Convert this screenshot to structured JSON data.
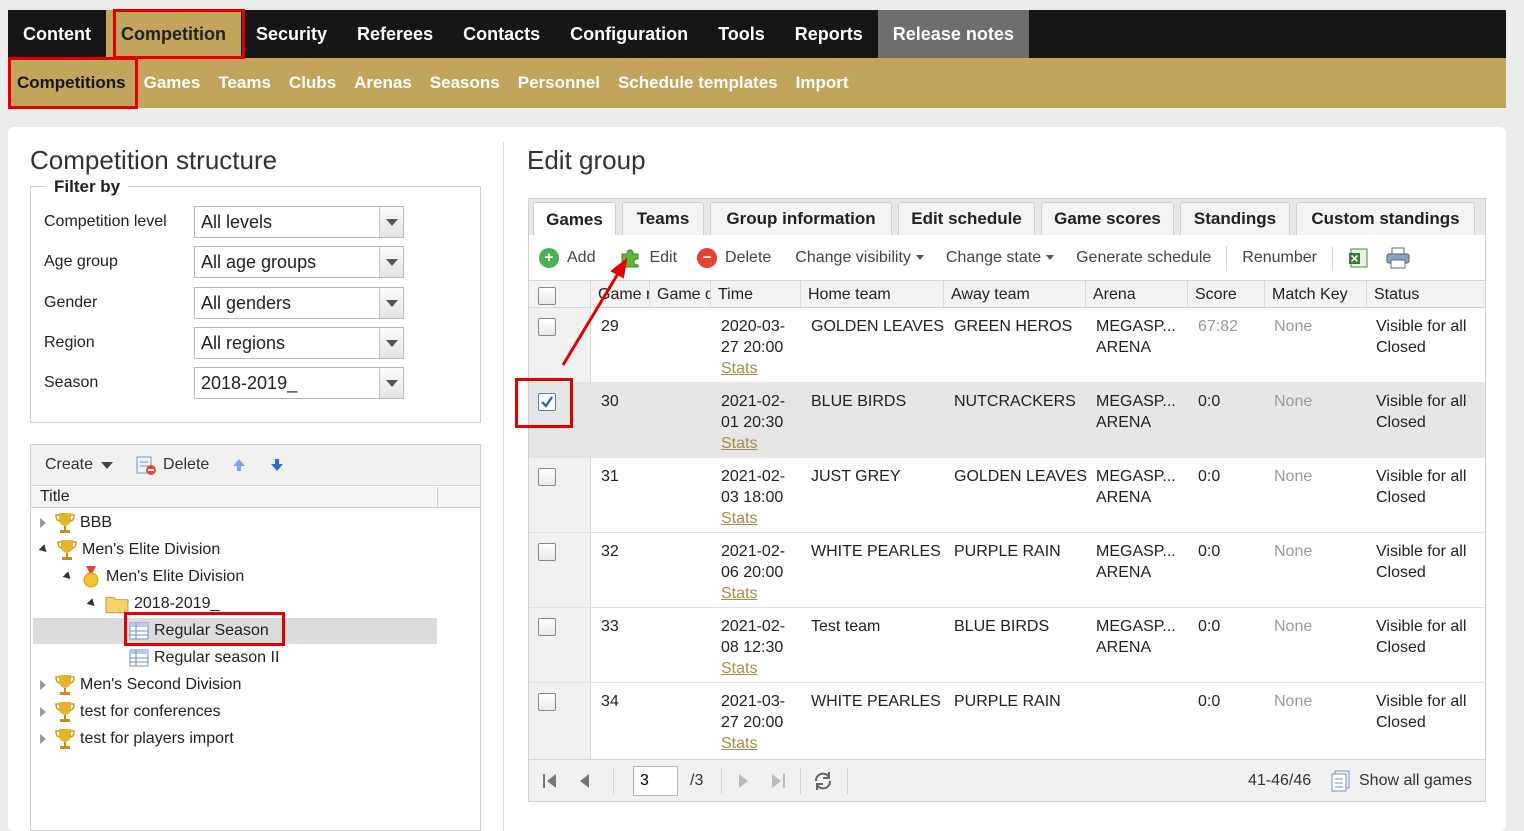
{
  "topnav": {
    "items": [
      "Content",
      "Competition",
      "Security",
      "Referees",
      "Contacts",
      "Configuration",
      "Tools",
      "Reports",
      "Release notes"
    ]
  },
  "subnav": {
    "items": [
      "Competitions",
      "Games",
      "Teams",
      "Clubs",
      "Arenas",
      "Seasons",
      "Personnel",
      "Schedule templates",
      "Import"
    ]
  },
  "left": {
    "title": "Competition structure",
    "filter_legend": "Filter by",
    "filters": [
      {
        "label": "Competition level",
        "value": "All levels"
      },
      {
        "label": "Age group",
        "value": "All age groups"
      },
      {
        "label": "Gender",
        "value": "All genders"
      },
      {
        "label": "Region",
        "value": "All regions"
      },
      {
        "label": "Season",
        "value": "2018-2019_"
      }
    ],
    "tree_toolbar": {
      "create": "Create",
      "delete": "Delete"
    },
    "tree_header": "Title",
    "tree": [
      {
        "label": "BBB"
      },
      {
        "label": "Men's Elite Division"
      },
      {
        "label": "Men's Elite Division"
      },
      {
        "label": "2018-2019_"
      },
      {
        "label": "Regular Season"
      },
      {
        "label": "Regular season II"
      },
      {
        "label": "Men's Second Division"
      },
      {
        "label": "test for conferences"
      },
      {
        "label": "test for players import"
      }
    ]
  },
  "right": {
    "title": "Edit group",
    "tabs": [
      "Games",
      "Teams",
      "Group information",
      "Edit schedule",
      "Game scores",
      "Standings",
      "Custom standings"
    ],
    "toolbar": {
      "add": "Add",
      "edit": "Edit",
      "delete": "Delete",
      "change_visibility": "Change visibility",
      "change_state": "Change state",
      "generate_schedule": "Generate schedule",
      "renumber": "Renumber"
    },
    "columns": [
      "Game n",
      "Game d",
      "Time",
      "Home team",
      "Away team",
      "Arena",
      "Score",
      "Match Key",
      "Status"
    ],
    "rows": [
      {
        "game": "29",
        "date": "2020-03-",
        "time": "27 20:00",
        "stats": "Stats",
        "home": "GOLDEN LEAVES",
        "away": "GREEN HEROS",
        "arena1": "MEGASP...",
        "arena2": "ARENA",
        "score": "67:82",
        "key": "None",
        "vis": "Visible for all",
        "state": "Closed"
      },
      {
        "game": "30",
        "date": "2021-02-",
        "time": "01 20:30",
        "stats": "Stats",
        "home": "BLUE BIRDS",
        "away": "NUTCRACKERS",
        "arena1": "MEGASP...",
        "arena2": "ARENA",
        "score": "0:0",
        "key": "None",
        "vis": "Visible for all",
        "state": "Closed"
      },
      {
        "game": "31",
        "date": "2021-02-",
        "time": "03 18:00",
        "stats": "Stats",
        "home": "JUST GREY",
        "away": "GOLDEN LEAVES",
        "arena1": "MEGASP...",
        "arena2": "ARENA",
        "score": "0:0",
        "key": "None",
        "vis": "Visible for all",
        "state": "Closed"
      },
      {
        "game": "32",
        "date": "2021-02-",
        "time": "06 20:00",
        "stats": "Stats",
        "home": "WHITE PEARLES",
        "away": "PURPLE RAIN",
        "arena1": "MEGASP...",
        "arena2": "ARENA",
        "score": "0:0",
        "key": "None",
        "vis": "Visible for all",
        "state": "Closed"
      },
      {
        "game": "33",
        "date": "2021-02-",
        "time": "08 12:30",
        "stats": "Stats",
        "home": "Test team",
        "away": "BLUE BIRDS",
        "arena1": "MEGASP...",
        "arena2": "ARENA",
        "score": "0:0",
        "key": "None",
        "vis": "Visible for all",
        "state": "Closed"
      },
      {
        "game": "34",
        "date": "2021-03-",
        "time": "27 20:00",
        "stats": "Stats",
        "home": "WHITE PEARLES",
        "away": "PURPLE RAIN",
        "arena1": "",
        "arena2": "",
        "score": "0:0",
        "key": "None",
        "vis": "Visible for all",
        "state": "Closed"
      }
    ],
    "pager": {
      "page": "3",
      "of": "/3",
      "range": "41-46/46",
      "show_all": "Show all games"
    }
  },
  "colors": {
    "accent": "#c2a45c",
    "nav": "#161616",
    "highlight": "#e00000"
  }
}
